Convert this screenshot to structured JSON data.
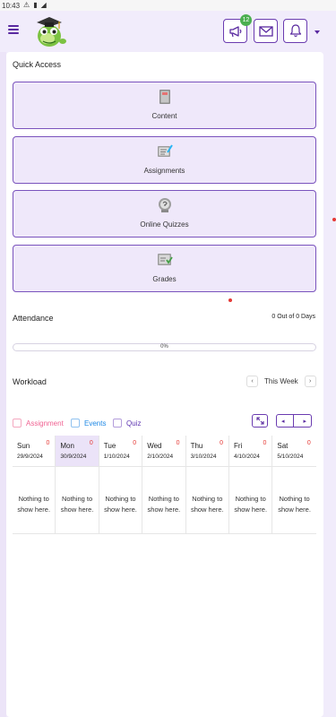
{
  "status_bar": {
    "time": "10:43",
    "icons": [
      "warning-icon",
      "sim-icon",
      "no-signal-icon"
    ]
  },
  "header": {
    "announcements_badge": "12",
    "icons": [
      "menu-icon",
      "megaphone-icon",
      "mail-icon",
      "bell-icon",
      "dropdown-caret-icon"
    ]
  },
  "quick_access": {
    "title": "Quick Access",
    "tiles": [
      {
        "label": "Content",
        "icon": "book-icon"
      },
      {
        "label": "Assignments",
        "icon": "assignment-icon"
      },
      {
        "label": "Online Quizzes",
        "icon": "quiz-icon"
      },
      {
        "label": "Grades",
        "icon": "grades-icon"
      }
    ]
  },
  "attendance": {
    "title": "Attendance",
    "value": "0 Out of 0 Days",
    "percent_label": "0%",
    "percent": 0
  },
  "workload": {
    "title": "Workload",
    "week_label": "This Week",
    "legend": [
      {
        "label": "Assignment",
        "color": "#f06292"
      },
      {
        "label": "Events",
        "color": "#1e88e5"
      },
      {
        "label": "Quiz",
        "color": "#5e35b1"
      }
    ],
    "days": [
      {
        "name": "Sun",
        "date": "29/9/2024",
        "count": "0",
        "empty": "Nothing to show here."
      },
      {
        "name": "Mon",
        "date": "30/9/2024",
        "count": "0",
        "empty": "Nothing to show here."
      },
      {
        "name": "Tue",
        "date": "1/10/2024",
        "count": "0",
        "empty": "Nothing to show here."
      },
      {
        "name": "Wed",
        "date": "2/10/2024",
        "count": "0",
        "empty": "Nothing to show here."
      },
      {
        "name": "Thu",
        "date": "3/10/2024",
        "count": "0",
        "empty": "Nothing to show here."
      },
      {
        "name": "Fri",
        "date": "4/10/2024",
        "count": "0",
        "empty": "Nothing to show here."
      },
      {
        "name": "Sat",
        "date": "5/10/2024",
        "count": "0",
        "empty": "Nothing to show here."
      }
    ]
  },
  "colors": {
    "accent": "#6a3bb0",
    "tile_bg": "#efe8fa",
    "page_bg": "#f1ecfb",
    "count_red": "#e53935",
    "badge_green": "#4caf50"
  }
}
